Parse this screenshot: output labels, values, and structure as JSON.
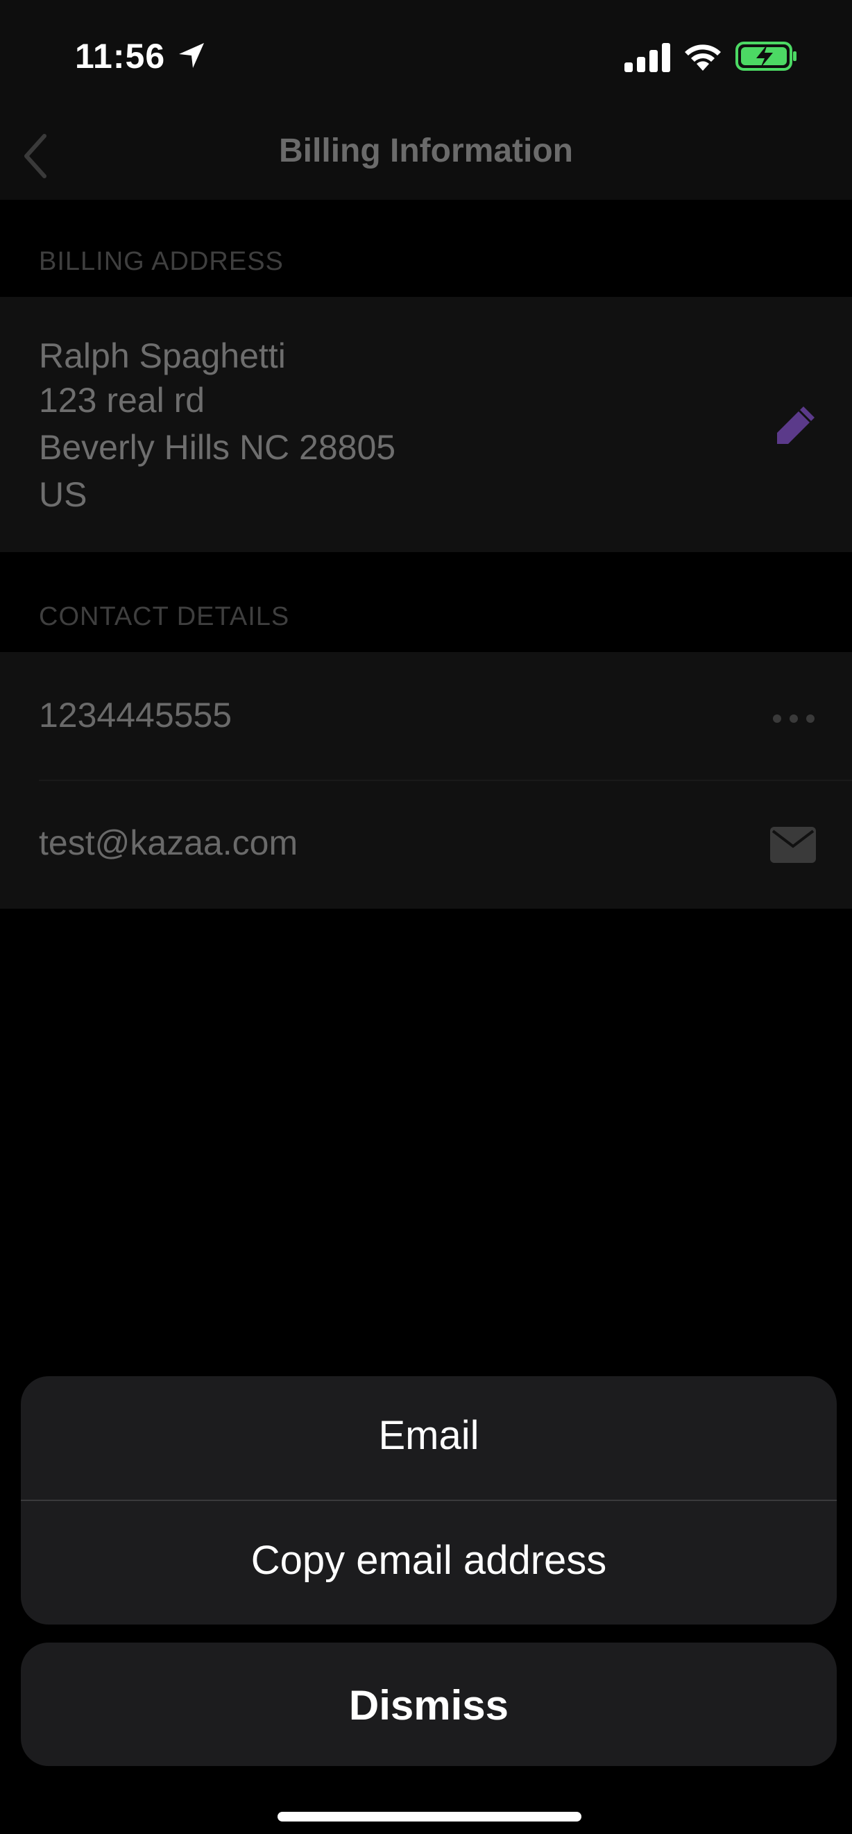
{
  "status_bar": {
    "time": "11:56",
    "icons": [
      "location-arrow-icon",
      "cellular-signal-icon",
      "wifi-icon",
      "battery-charging-icon"
    ],
    "battery_color": "#4cd964"
  },
  "nav": {
    "title": "Billing Information",
    "back_icon": "chevron-left-icon"
  },
  "billing_address": {
    "header": "BILLING ADDRESS",
    "lines": [
      "Ralph Spaghetti",
      "123 real rd",
      "Beverly Hills NC 28805",
      "US"
    ],
    "edit_icon": "pencil-icon",
    "edit_icon_color": "#5b3a8a"
  },
  "contact_details": {
    "header": "CONTACT DETAILS",
    "phone": "1234445555",
    "phone_icon": "more-horizontal-icon",
    "email": "test@kazaa.com",
    "email_icon": "envelope-icon"
  },
  "action_sheet": {
    "options": [
      "Email",
      "Copy email address"
    ],
    "dismiss_label": "Dismiss"
  }
}
